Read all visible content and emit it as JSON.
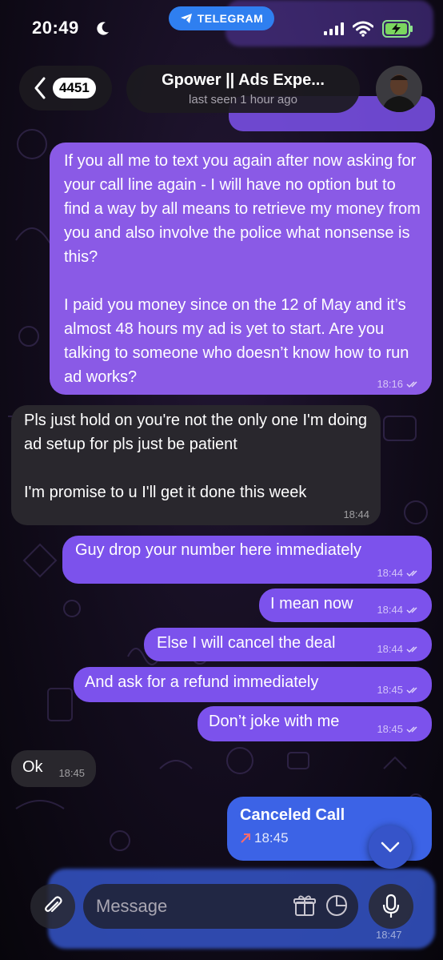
{
  "status_bar": {
    "time": "20:49",
    "app_pill_label": "TELEGRAM"
  },
  "header": {
    "unread_count": "4451",
    "chat_name": "Gpower || Ads Expe...",
    "last_seen": "last seen 1 hour ago"
  },
  "messages": [
    {
      "direction": "outgoing",
      "text": "If you all me to text you again after now asking for your call line again - I will have no option but to find a way by all means to retrieve my money from you and also involve the police what nonsense is this?\n\nI paid you money since on the 12 of May and it’s almost 48 hours my ad is yet to start. Are you talking to someone who doesn’t know how to run ad works?",
      "time": "18:16"
    },
    {
      "direction": "incoming",
      "text": "Pls just hold on you're not the only one I'm doing ad setup for pls just be patient\n\nI'm promise to u I'll get it done this week",
      "time": "18:44"
    },
    {
      "direction": "outgoing",
      "text": "Guy drop your number here immediately",
      "time": "18:44"
    },
    {
      "direction": "outgoing",
      "text": "I mean now",
      "time": "18:44"
    },
    {
      "direction": "outgoing",
      "text": "Else I will cancel the deal",
      "time": "18:44"
    },
    {
      "direction": "outgoing",
      "text": "And ask for a refund immediately",
      "time": "18:45"
    },
    {
      "direction": "outgoing",
      "text": "Don’t joke with me",
      "time": "18:45"
    },
    {
      "direction": "incoming",
      "text": "Ok",
      "time": "18:45"
    }
  ],
  "call": {
    "title": "Canceled Call",
    "time": "18:45",
    "ghost_title": "Canceled Call",
    "ghost_time": "18:45"
  },
  "input": {
    "placeholder": "Message",
    "bottom_time": "18:47"
  },
  "colors": {
    "outgoing_bubble": "#8a5ae6",
    "incoming_bubble": "#29272d",
    "call_bubble": "#3c63e6",
    "telegram_pill": "#2f7ff0"
  }
}
